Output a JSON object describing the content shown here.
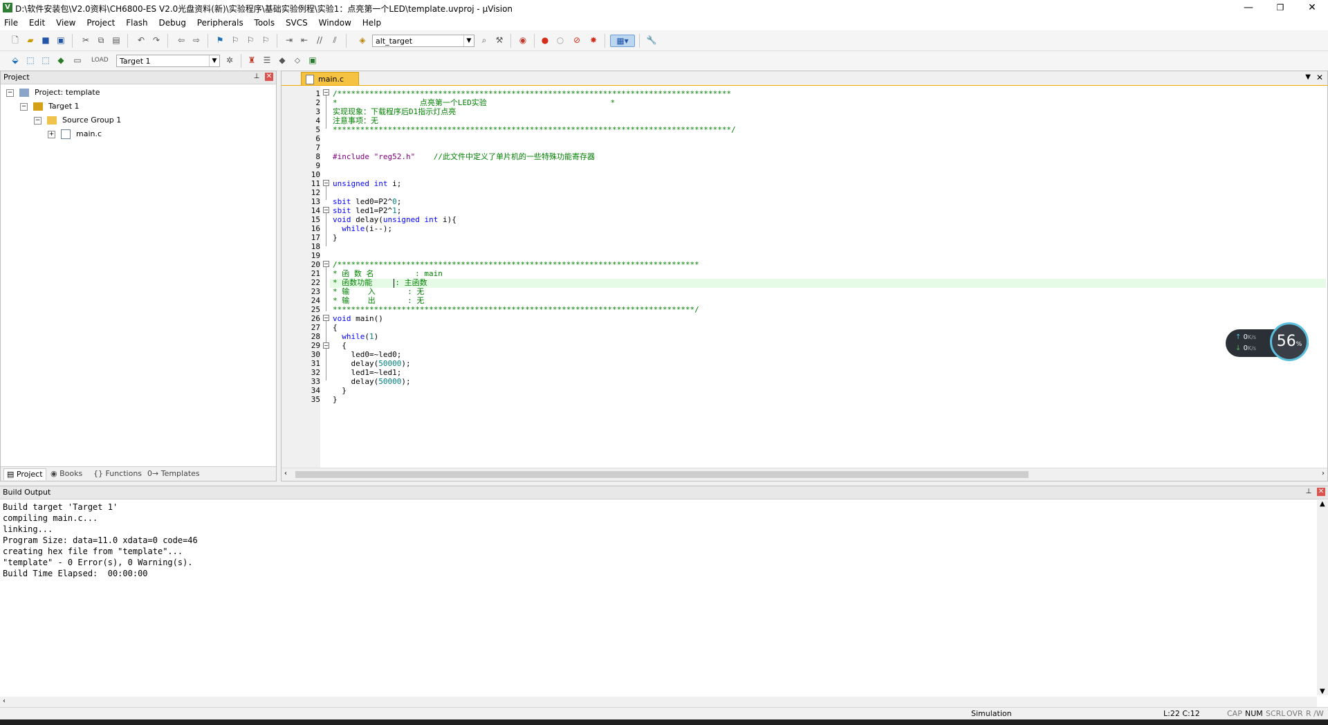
{
  "window": {
    "title": "D:\\软件安装包\\V2.0资料\\CH6800-ES V2.0光盘资料(新)\\实验程序\\基础实验例程\\实验1：点亮第一个LED\\template.uvproj - µVision",
    "minimize": "—",
    "restore": "❐",
    "close": "✕"
  },
  "menu": [
    {
      "label": "File"
    },
    {
      "label": "Edit"
    },
    {
      "label": "View"
    },
    {
      "label": "Project"
    },
    {
      "label": "Flash"
    },
    {
      "label": "Debug"
    },
    {
      "label": "Peripherals"
    },
    {
      "label": "Tools"
    },
    {
      "label": "SVCS"
    },
    {
      "label": "Window"
    },
    {
      "label": "Help"
    }
  ],
  "toolbar": {
    "target_combo": "alt_target",
    "target_select": "Target 1"
  },
  "project_panel": {
    "title": "Project",
    "tree": {
      "root": "Project: template",
      "target": "Target 1",
      "group": "Source Group 1",
      "file": "main.c"
    },
    "tabs": [
      {
        "label": "Project"
      },
      {
        "label": "Books"
      },
      {
        "label": "Functions"
      },
      {
        "label": "Templates"
      }
    ]
  },
  "editor": {
    "active_tab": "main.c",
    "line_numbers": [
      "1",
      "2",
      "3",
      "4",
      "5",
      "6",
      "7",
      "8",
      "9",
      "10",
      "11",
      "12",
      "13",
      "14",
      "15",
      "16",
      "17",
      "18",
      "19",
      "20",
      "21",
      "22",
      "23",
      "24",
      "25",
      "26",
      "27",
      "28",
      "29",
      "30",
      "31",
      "32",
      "33",
      "34",
      "35"
    ],
    "lines": {
      "l1": "/**************************************************************************************",
      "l2": "*                  点亮第一个LED实验                           *",
      "l3": "实现现象：下载程序后D1指示灯点亮",
      "l4": "注意事项：无",
      "l5": "***************************************************************************************/",
      "l8a": "#include \"reg52.h\"",
      "l8b": "    //此文件中定义了单片机的一些特殊功能寄存器",
      "l11a": "unsigned int",
      "l11b": " i;",
      "l13a": "sbit",
      "l13b": " led0=P2^",
      "l13c": "0",
      "l13d": ";",
      "l14a": "sbit",
      "l14b": " led1=P2^",
      "l14c": "1",
      "l14d": ";",
      "l15a": "void",
      "l15b": " delay(",
      "l15c": "unsigned int",
      "l15d": " i){",
      "l16a": "  while",
      "l16b": "(i--);",
      "l17": "}",
      "l19": "/*******************************************************************************",
      "l20": "* 函 数 名         : main",
      "l21": "* 函数功能     : 主函数",
      "l22": "* 输    入       : 无",
      "l23": "* 输    出       : 无",
      "l24": "*******************************************************************************/",
      "l25a": "void",
      "l25b": " main()",
      "l26": "{",
      "l27a": "  while",
      "l27b": "(",
      "l27c": "1",
      "l27d": ")",
      "l28": "  {",
      "l29": "    led0=~led0;",
      "l30a": "    delay(",
      "l30b": "50000",
      "l30c": ");",
      "l31": "    led1=~led1;",
      "l32a": "    delay(",
      "l32b": "50000",
      "l32c": ");",
      "l33": "  }",
      "l34": "}"
    }
  },
  "build_output": {
    "title": "Build Output",
    "lines": [
      "Build target 'Target 1'",
      "compiling main.c...",
      "linking...",
      "Program Size: data=11.0 xdata=0 code=46",
      "creating hex file from \"template\"...",
      "\"template\" - 0 Error(s), 0 Warning(s).",
      "Build Time Elapsed:  00:00:00"
    ]
  },
  "statusbar": {
    "mode": "Simulation",
    "position": "L:22 C:12",
    "cap": "CAP",
    "num": "NUM",
    "scrl": "SCRL",
    "ovr": "OVR",
    "rw": "R /W"
  },
  "speed_widget": {
    "up": "0",
    "down": "0",
    "unit": "K/s",
    "percent": "56",
    "percent_sign": "%"
  }
}
